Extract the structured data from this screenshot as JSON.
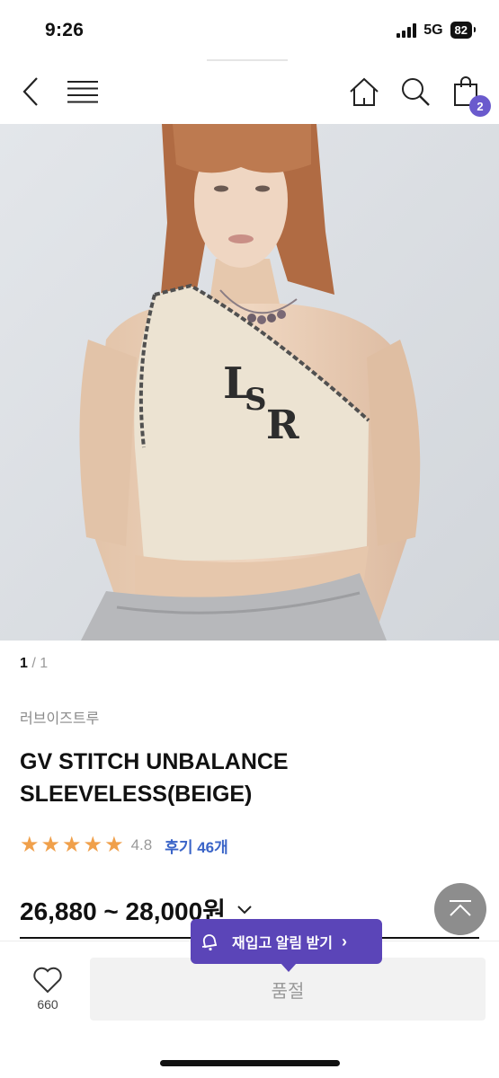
{
  "status": {
    "time": "9:26",
    "network": "5G",
    "battery": "82"
  },
  "header": {
    "cart_count": "2",
    "icons": [
      "back-icon",
      "menu-icon",
      "home-icon",
      "search-icon",
      "shopping-bag-icon"
    ]
  },
  "image": {
    "current": "1",
    "total": "/ 1"
  },
  "product": {
    "brand": "러브이즈트루",
    "name": "GV STITCH UNBALANCE SLEEVELESS(BEIGE)",
    "rating_value": "4.8",
    "stars": 5,
    "review_label": "후기 46개",
    "price": "26,880 ~ 28,000원"
  },
  "restock": {
    "label": "재입고 알림 받기",
    "arrow": "›"
  },
  "bottom": {
    "wish_count": "660",
    "soldout_label": "품절"
  },
  "colors": {
    "accent": "#5b45b8",
    "badge": "#6a5acd",
    "star": "#f0a04b",
    "review": "#3a64c8"
  }
}
